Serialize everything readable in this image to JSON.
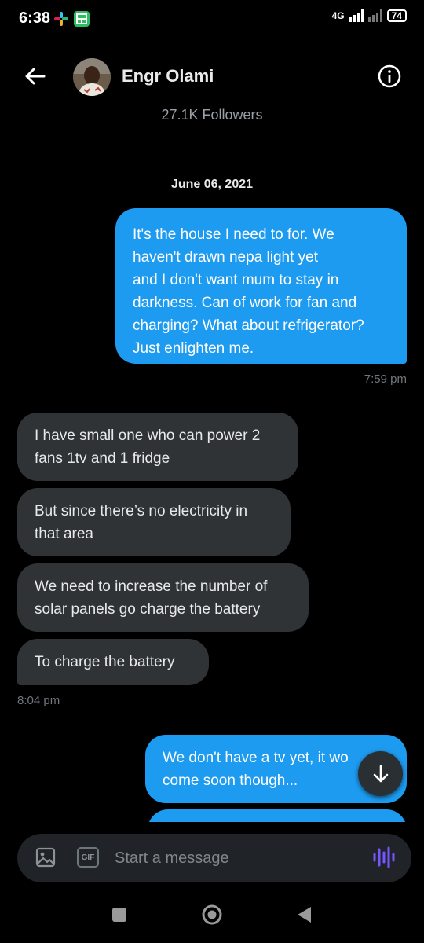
{
  "status_bar": {
    "time": "6:38",
    "network": "4G",
    "battery": "74",
    "app_icon_colors": [
      "#3b9a58",
      "#2dbe60"
    ]
  },
  "header": {
    "contact_name": "Engr Olami",
    "followers": "27.1K Followers",
    "back_icon": "arrow-left-icon",
    "info_icon": "info-circle-icon"
  },
  "conversation": {
    "date": "June 06, 2021",
    "messages": [
      {
        "side": "sent",
        "text": "It's the house I need to for. We\nhaven't drawn nepa light yet\nand I don't want mum to stay in\ndarkness. Can of work for fan and\ncharging? What about refrigerator?\nJust enlighten me."
      },
      {
        "side": "received",
        "text": "I have small one who can power 2\nfans 1tv and 1 fridge"
      },
      {
        "side": "received",
        "text": "But since there’s no electricity in\nthat area"
      },
      {
        "side": "received",
        "text": "We need to increase the number of\nsolar panels go charge the battery"
      },
      {
        "side": "received",
        "text": "To charge the battery"
      },
      {
        "side": "sent",
        "text": "We don't have a tv yet, it wo\ncome soon though..."
      }
    ],
    "timestamps": {
      "sent_1": "7:59 pm",
      "received_group": "8:04 pm"
    }
  },
  "composer": {
    "placeholder": "Start a message",
    "gif_label": "GIF",
    "image_icon": "image-icon",
    "voice_icon": "voice-waveform-icon"
  },
  "colors": {
    "sent_bubble": "#1d9bf0",
    "received_bubble": "#2f3336",
    "voice_accent": "#7856ff",
    "background": "#000000"
  }
}
